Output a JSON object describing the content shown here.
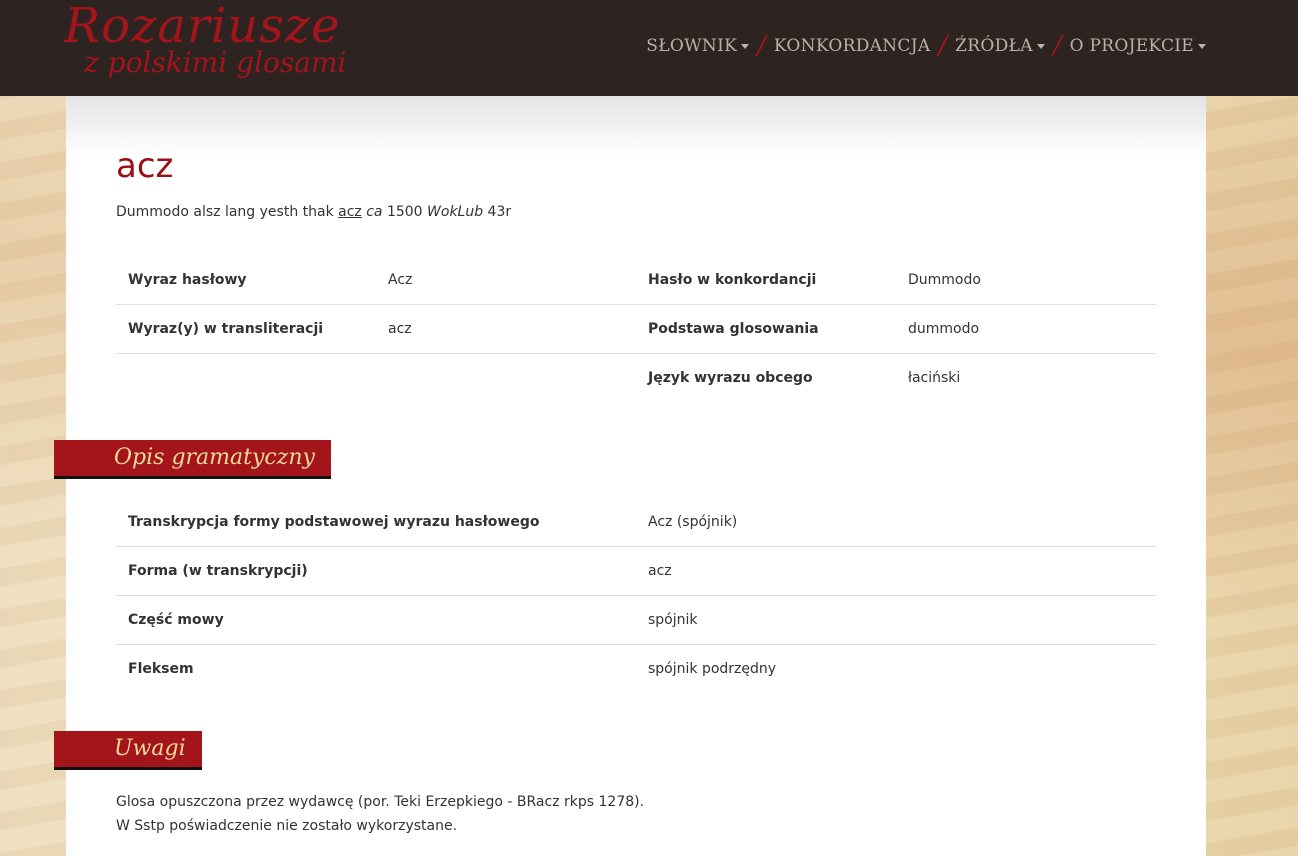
{
  "header": {
    "logo_line1": "Rozariusze",
    "logo_line2": "z polskimi glosami",
    "nav": [
      {
        "label": "SŁOWNIK",
        "dropdown": true
      },
      {
        "label": "KONKORDANCJA",
        "dropdown": false
      },
      {
        "label": "ŹRÓDŁA",
        "dropdown": true
      },
      {
        "label": "O PROJEKCIE",
        "dropdown": true
      }
    ]
  },
  "entry": {
    "title": "acz",
    "quote_pre": "Dummodo alsz lang yesth thak ",
    "quote_word": "acz",
    "quote_ca": "ca",
    "quote_year": " 1500 ",
    "quote_source": "WokLub",
    "quote_page": " 43r"
  },
  "info": {
    "rows": [
      {
        "l1": "Wyraz hasłowy",
        "v1": "Acz",
        "l2": "Hasło w konkordancji",
        "v2": "Dummodo"
      },
      {
        "l1": "Wyraz(y) w transliteracji",
        "v1": "acz",
        "l2": "Podstawa glosowania",
        "v2": "dummodo"
      },
      {
        "l1": "",
        "v1": "",
        "l2": "Język wyrazu obcego",
        "v2": "łaciński"
      }
    ]
  },
  "grammar": {
    "heading": "Opis gramatyczny",
    "rows": [
      {
        "label": "Transkrypcja formy podstawowej wyrazu hasłowego",
        "value": "Acz (spójnik)"
      },
      {
        "label": "Forma (w transkrypcji)",
        "value": "acz"
      },
      {
        "label": "Część mowy",
        "value": "spójnik"
      },
      {
        "label": "Fleksem",
        "value": "spójnik podrzędny"
      }
    ]
  },
  "notes": {
    "heading": "Uwagi",
    "line1": "Glosa opuszczona przez wydawcę (por. Teki Erzepkiego - BRacz rkps 1278).",
    "line2": "W Sstp poświadczenie nie zostało wykorzystane."
  },
  "colors": {
    "accent": "#a3141b",
    "header_bg": "#2d2320",
    "tab_text": "#f0d99a"
  }
}
